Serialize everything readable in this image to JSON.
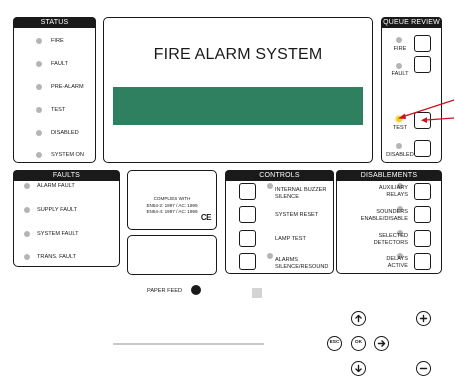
{
  "lcd": {
    "title": "FIRE ALARM SYSTEM"
  },
  "status": {
    "header": "STATUS",
    "items": [
      {
        "label": "FIRE"
      },
      {
        "label": "FAULT"
      },
      {
        "label": "PRE-ALARM"
      },
      {
        "label": "TEST"
      },
      {
        "label": "DISABLED"
      },
      {
        "label": "SYSTEM ON"
      }
    ]
  },
  "queue_review": {
    "header": "QUEUE REVIEW",
    "items": [
      {
        "label": "FIRE",
        "led": "off"
      },
      {
        "label": "FAULT",
        "led": "off"
      },
      {
        "label": "TEST",
        "led": "on"
      },
      {
        "label": "DISABLED",
        "led": "off"
      }
    ]
  },
  "faults": {
    "header": "FAULTS",
    "items": [
      {
        "label": "ALARM FAULT"
      },
      {
        "label": "SUPPLY FAULT"
      },
      {
        "label": "SYSTEM FAULT"
      },
      {
        "label": "TRANS. FAULT"
      }
    ]
  },
  "certification": {
    "line1": "COMPLIES WITH",
    "line2": "EN54-2: 1997 / AC: 1999",
    "line3": "EN54-4: 1997 / AC: 1999",
    "mark": "CE"
  },
  "controls": {
    "header": "CONTROLS",
    "items": [
      {
        "label_1": "INTERNAL BUZZER",
        "label_2": "SILENCE"
      },
      {
        "label_1": "SYSTEM RESET",
        "label_2": ""
      },
      {
        "label_1": "LAMP TEST",
        "label_2": ""
      },
      {
        "label_1": "ALARMS",
        "label_2": "SILENCE/RESOUND"
      }
    ]
  },
  "disablements": {
    "header": "DISABLEMENTS",
    "items": [
      {
        "label_1": "AUXILIARY",
        "label_2": "RELAYS"
      },
      {
        "label_1": "SOUNDERS",
        "label_2": "ENABLE/DISABLE"
      },
      {
        "label_1": "SELECTED",
        "label_2": "DETECTORS"
      },
      {
        "label_1": "DELAYS",
        "label_2": "ACTIVE"
      }
    ]
  },
  "paper_feed": {
    "label": "PAPER FEED"
  },
  "navigation": {
    "esc": "ESC",
    "ok": "OK"
  },
  "colors": {
    "lcd_screen": "#2f8060",
    "led_off": "#b5b5b5",
    "led_on": "#f2d21e",
    "pointer_arrow": "#d0101c",
    "outline": "#1a1a1a"
  }
}
